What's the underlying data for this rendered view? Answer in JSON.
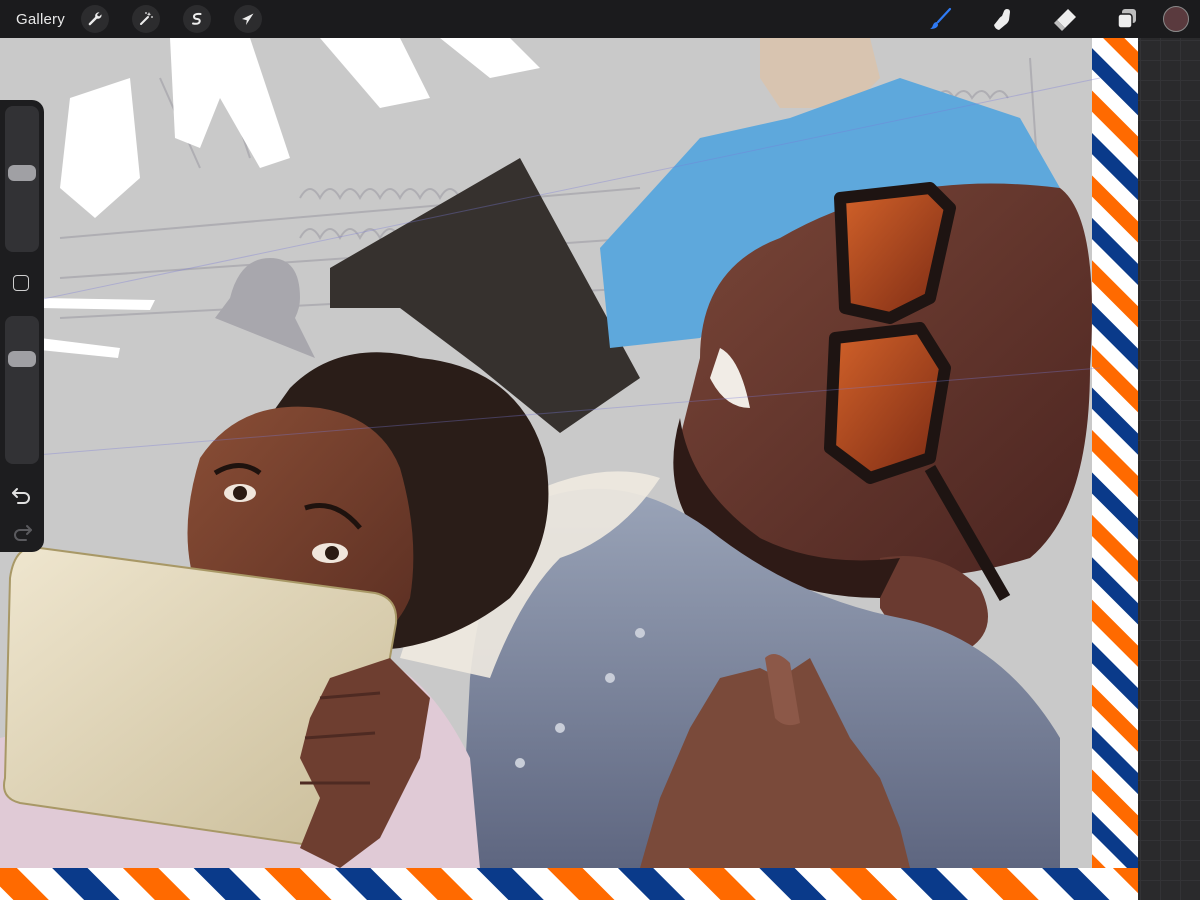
{
  "toolbar": {
    "gallery_label": "Gallery",
    "left_tools": [
      {
        "name": "actions",
        "icon": "wrench-icon"
      },
      {
        "name": "adjustments",
        "icon": "magic-wand-icon"
      },
      {
        "name": "selection",
        "icon": "selection-s-icon"
      },
      {
        "name": "transform",
        "icon": "arrow-cursor-icon"
      }
    ],
    "right_tools": [
      {
        "name": "brush",
        "icon": "brush-icon",
        "active": true
      },
      {
        "name": "smudge",
        "icon": "smudge-finger-icon",
        "active": false
      },
      {
        "name": "eraser",
        "icon": "eraser-icon",
        "active": false
      },
      {
        "name": "layers",
        "icon": "layers-icon",
        "active": false
      }
    ],
    "current_color": "#5a3a3e",
    "active_color": "#2f7bf5"
  },
  "sidebar": {
    "brush_size_level": 0.55,
    "opacity_level": 0.75,
    "modify_icon": "square-icon",
    "undo_icon": "undo-icon",
    "redo_icon": "redo-icon"
  },
  "canvas": {
    "background_color": "#c9c9c9",
    "border_colors": [
      "#ff6a00",
      "#ffffff",
      "#0a3a8a"
    ]
  }
}
